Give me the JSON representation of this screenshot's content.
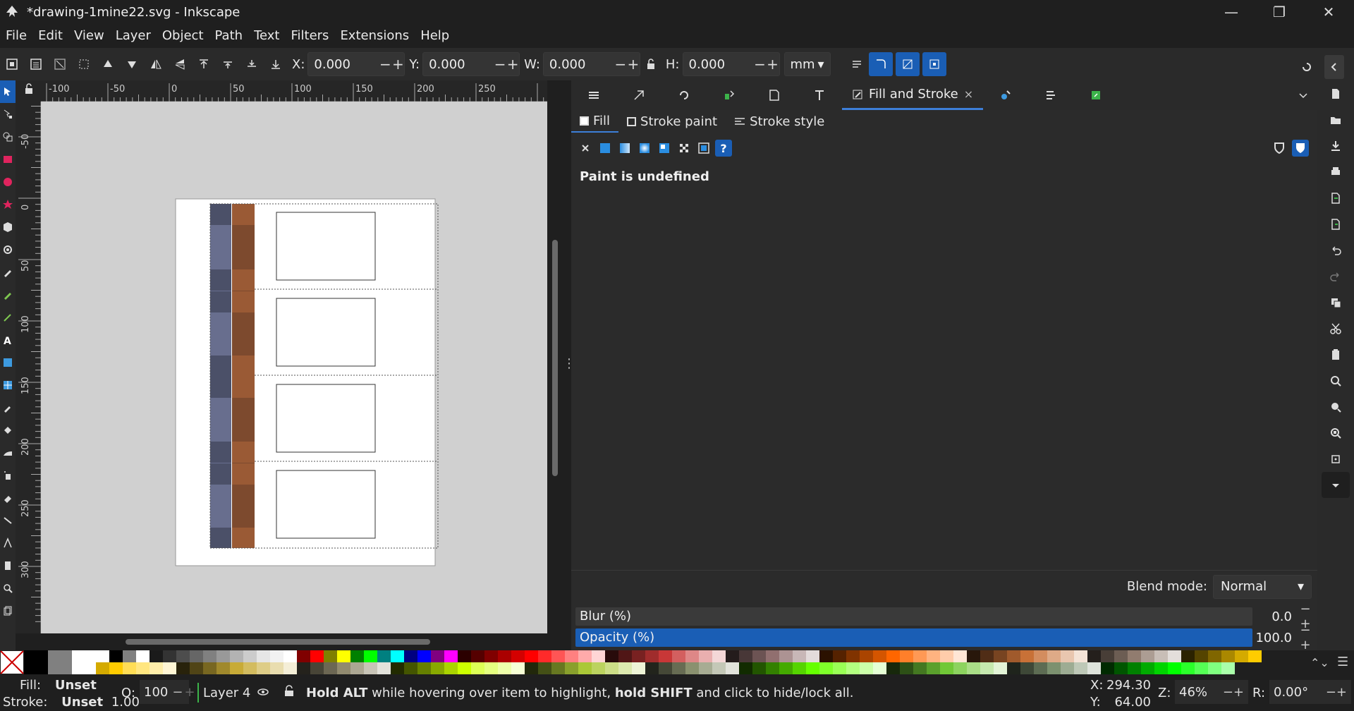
{
  "window": {
    "title": "*drawing-1mine22.svg - Inkscape",
    "minimize": "—",
    "restore": "❐",
    "close": "✕"
  },
  "menu": [
    "File",
    "Edit",
    "View",
    "Layer",
    "Object",
    "Path",
    "Text",
    "Filters",
    "Extensions",
    "Help"
  ],
  "toolbar": {
    "x_label": "X:",
    "x_value": "0.000",
    "y_label": "Y:",
    "y_value": "0.000",
    "w_label": "W:",
    "w_value": "0.000",
    "h_label": "H:",
    "h_value": "0.000",
    "unit": "mm",
    "minus": "−",
    "plus": "+"
  },
  "ruler_top_labels": [
    "-100",
    "-50",
    "0",
    "50",
    "100",
    "150",
    "200",
    "250"
  ],
  "ruler_left_labels": [
    "-50",
    "0",
    "50",
    "100",
    "150",
    "200",
    "250",
    "300"
  ],
  "dock": {
    "active_tab": "Fill and Stroke",
    "close_x": "×",
    "paint_tabs": [
      "Fill",
      "Stroke paint",
      "Stroke style"
    ],
    "message": "Paint is undefined",
    "blend_label": "Blend mode:",
    "blend_value": "Normal",
    "blur_label": "Blur (%)",
    "blur_value": "0.0",
    "opacity_label": "Opacity (%)",
    "opacity_value": "100.0",
    "opacity_fraction": 1.0,
    "blur_fraction": 0.0,
    "unknown_mark": "?"
  },
  "status": {
    "fill_label": "Fill:",
    "fill_value": "Unset",
    "stroke_label": "Stroke:",
    "stroke_value": "Unset",
    "stroke_width": "1.00",
    "opacity_label": "O:",
    "opacity_value": "100",
    "layer": "Layer 4",
    "hint_bold1": "Hold ALT",
    "hint_mid": " while hovering over item to highlight, ",
    "hint_bold2": "hold SHIFT",
    "hint_end": " and click to hide/lock all.",
    "x_label": "X:",
    "x_value": "294.30",
    "y_label": "Y:",
    "y_value": "64.00",
    "zoom_label": "Z:",
    "zoom_value": "46%",
    "rot_label": "R:",
    "rot_value": "0.00°"
  },
  "palette_row1": [
    "#ffffff",
    "#000000",
    "#808080",
    "#ffffff",
    "#1a1a1a",
    "#333333",
    "#4d4d4d",
    "#666666",
    "#808080",
    "#999999",
    "#b3b3b3",
    "#cccccc",
    "#e6e6e6",
    "#f2f2f2",
    "#ffffff",
    "#800000",
    "#ff0000",
    "#808000",
    "#ffff00",
    "#008000",
    "#00ff00",
    "#008080",
    "#00ffff",
    "#000080",
    "#0000ff",
    "#800080",
    "#ff00ff",
    "#2b0000",
    "#550000",
    "#800000",
    "#aa0000",
    "#d40000",
    "#ff0000",
    "#ff2a2a",
    "#ff5555",
    "#ff8080",
    "#ffaaaa",
    "#ffd5d5",
    "#280b0b",
    "#501616",
    "#782121",
    "#a02c2c",
    "#c83737",
    "#d35f5f",
    "#de8787",
    "#e9afaf",
    "#f4d7d7",
    "#241c1c",
    "#483737",
    "#6c5353",
    "#916f6f",
    "#ac9393",
    "#c8b7b7",
    "#e3dbdb",
    "#2b1100",
    "#552200",
    "#803300",
    "#aa4400",
    "#d45500",
    "#ff6600",
    "#ff7f2a",
    "#ff9955",
    "#ffb380",
    "#ffccaa",
    "#ffe6d5",
    "#28170b",
    "#502d16",
    "#784421",
    "#a05a2c",
    "#c87137",
    "#d38d5f",
    "#deaa87",
    "#e9c6af",
    "#f4e3d7",
    "#241f1c",
    "#483e37",
    "#6c5d53",
    "#917c6f",
    "#ac9d93",
    "#c8beb7",
    "#e3dedb",
    "#2b2200",
    "#554400",
    "#806600",
    "#aa8800",
    "#d4aa00",
    "#ffcc00"
  ],
  "palette_row2": [
    "#d4aa00",
    "#ffcc00",
    "#ffdd55",
    "#ffe680",
    "#ffeeaa",
    "#fff6d5",
    "#28220b",
    "#504416",
    "#786721",
    "#a0892c",
    "#c8ab37",
    "#d3bc5f",
    "#decd87",
    "#e9ddaf",
    "#f4eed7",
    "#24221c",
    "#484537",
    "#6c6753",
    "#918a6f",
    "#aca793",
    "#c8c4b7",
    "#e3e2db",
    "#222b00",
    "#445500",
    "#668000",
    "#88aa00",
    "#aad400",
    "#ccff00",
    "#ddff55",
    "#e5ff80",
    "#eeffaa",
    "#f6ffd5",
    "#22280b",
    "#445016",
    "#677821",
    "#89a02c",
    "#abc837",
    "#bcd35f",
    "#cdde87",
    "#dde9af",
    "#eef4d7",
    "#22241c",
    "#454837",
    "#676c53",
    "#8a916f",
    "#a7ac93",
    "#c4c8b7",
    "#e2e3db",
    "#112b00",
    "#225500",
    "#338000",
    "#44aa00",
    "#55d400",
    "#66ff00",
    "#7fff2a",
    "#99ff55",
    "#b3ff80",
    "#ccffaa",
    "#e5ffd5",
    "#17280b",
    "#2d5016",
    "#447821",
    "#5aa02c",
    "#71c837",
    "#8dd35f",
    "#aade87",
    "#c6e9af",
    "#e3f4d7",
    "#1f241c",
    "#3e4837",
    "#5d6c53",
    "#7c916f",
    "#9dac93",
    "#bec8b7",
    "#dee3db",
    "#002b00",
    "#005500",
    "#008000",
    "#00aa00",
    "#00d400",
    "#00ff00",
    "#2aff2a",
    "#55ff55",
    "#80ff80",
    "#aaffaa"
  ]
}
